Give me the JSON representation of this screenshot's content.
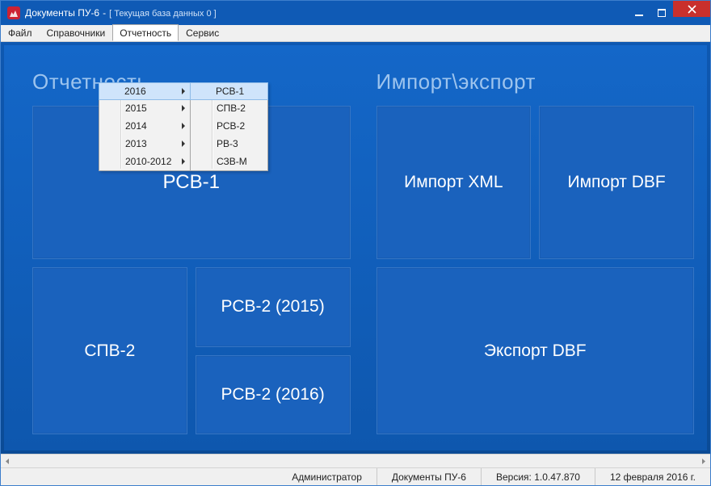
{
  "titlebar": {
    "app_title": "Документы ПУ-6",
    "separator": "-",
    "subtitle": "[ Текущая база данных 0 ]"
  },
  "menubar": {
    "items": [
      "Файл",
      "Справочники",
      "Отчетность",
      "Сервис"
    ],
    "open_index": 2
  },
  "dropdown_years": {
    "items": [
      "2016",
      "2015",
      "2014",
      "2013",
      "2010-2012"
    ],
    "hover_index": 0
  },
  "dropdown_sub": {
    "items": [
      "РСВ-1",
      "СПВ-2",
      "РСВ-2",
      "РВ-3",
      "СЗВ-М"
    ],
    "hover_index": 0
  },
  "sections": {
    "left_title": "Отчетность",
    "right_title": "Импорт\\экспорт"
  },
  "tiles": {
    "rsv1": "РСВ-1",
    "spv2": "СПВ-2",
    "rsv2_2015": "РСВ-2 (2015)",
    "rsv2_2016": "РСВ-2 (2016)",
    "import_xml": "Импорт XML",
    "import_dbf": "Импорт DBF",
    "export_dbf": "Экспорт DBF"
  },
  "statusbar": {
    "user": "Администратор",
    "doc": "Документы ПУ-6",
    "version_label": "Версия: 1.0.47.870",
    "date": "12 февраля 2016 г."
  }
}
